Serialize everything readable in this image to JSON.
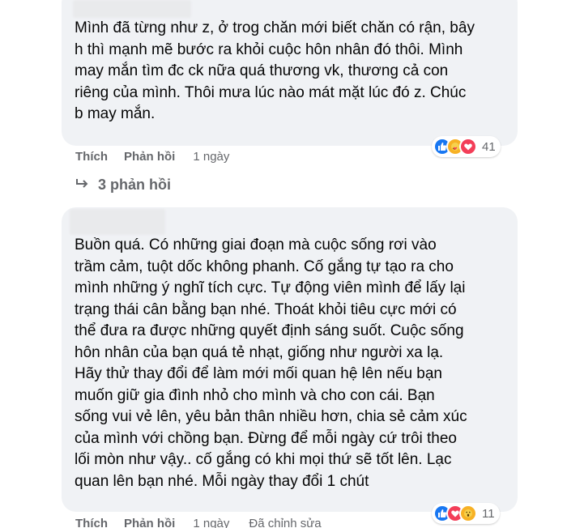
{
  "comments": [
    {
      "text": "Mình đã từng như z, ở trog chăn mới biết chăn có rận, bây\nh thì mạnh mẽ bước ra khỏi cuộc hôn nhân đó thôi. Mình\nmay mắn tìm đc ck nữa quá thương vk, thương cả con\nriêng của mình. Thôi mưa lúc nào mát mặt lúc đó z. Chúc\nb may mắn.",
      "like_label": "Thích",
      "reply_label": "Phản hồi",
      "time": "1 ngày",
      "reaction_icons": [
        "like-icon",
        "care-icon",
        "love-icon"
      ],
      "reaction_count": "41",
      "replies_label": "3 phản hồi"
    },
    {
      "text": "Buồn quá. Có những giai đoạn mà cuộc sống rơi vào\ntrầm cảm, tuột dốc không phanh. Cố gắng tự tạo ra cho\nmình những ý nghĩ tích cực. Tự động viên mình để lấy lại\ntrạng thái cân bằng bạn nhé. Thoát khỏi tiêu cực mới có\nthể đưa ra được những quyết định sáng suốt. Cuộc sống\nhôn nhân của bạn quá tẻ nhạt, giống như người xa lạ.\nHãy thử thay đổi để làm mới mối quan hệ lên nếu bạn\nmuốn giữ gia đình nhỏ cho mình và cho con cái. Bạn\nsống vui vẻ lên, yêu bản thân nhiều hơn, chia sẻ cảm xúc\ncủa mình với chồng bạn. Đừng để mỗi ngày cứ trôi theo\nlối mòn như vậy.. cố gắng có khi mọi thứ sẽ tốt lên. Lạc\nquan lên bạn nhé. Mỗi ngày thay đổi 1 chút",
      "like_label": "Thích",
      "reply_label": "Phản hồi",
      "time": "1 ngày",
      "edited_label": "Đã chỉnh sửa",
      "reaction_icons": [
        "like-icon",
        "love-icon",
        "wow-icon"
      ],
      "reaction_count": "11"
    }
  ],
  "colors": {
    "bubble_bg": "#f0f2f5",
    "secondary_text": "#65676b",
    "like_blue": "#1877f2",
    "love_red": "#f33e58",
    "care_yellow": "#f7b125"
  }
}
